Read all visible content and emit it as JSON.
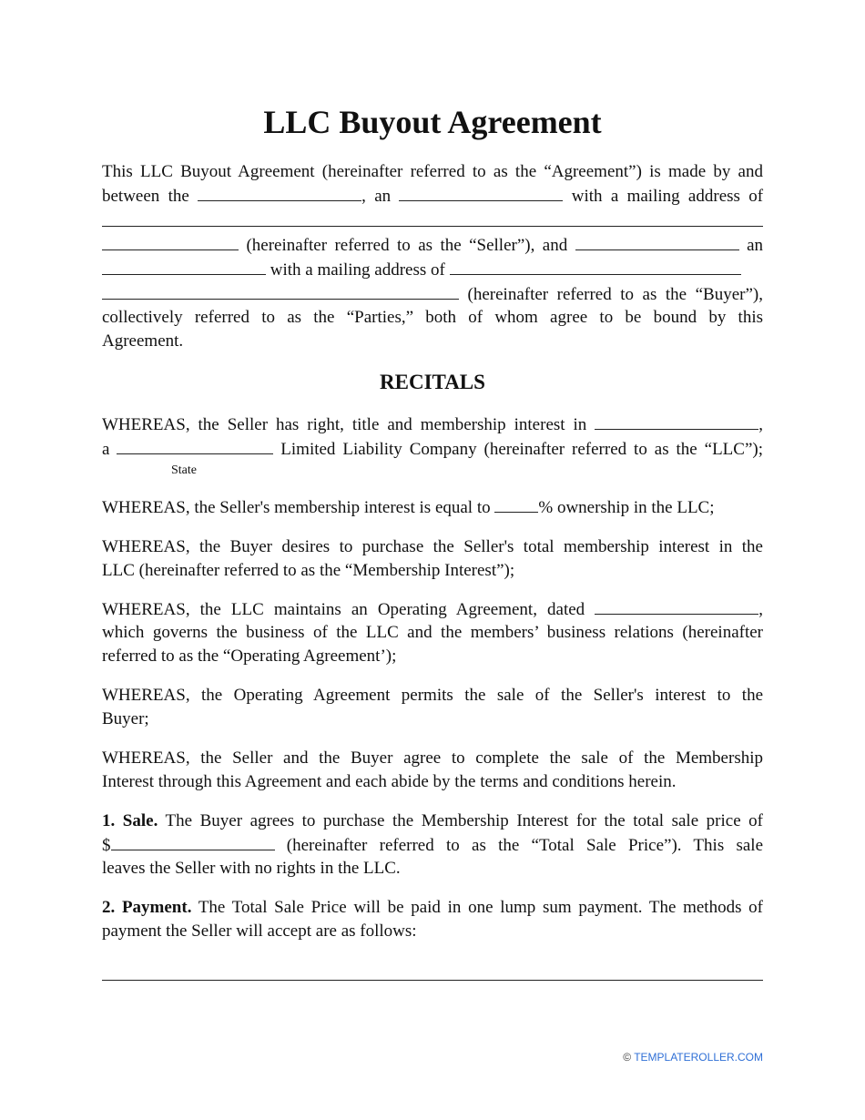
{
  "title": "LLC Buyout Agreement",
  "intro": {
    "l1": "This LLC Buyout Agreement (hereinafter referred to as the “Agreement”) is made by and",
    "l2a": "between the",
    "l2b": ", an",
    "l2c": "with a mailing address of",
    "l4": "(hereinafter referred to as the “Seller”), and",
    "l4b": "an",
    "l5": "with a mailing address of",
    "l6": "(hereinafter referred to as the “Buyer”),",
    "l7": "collectively referred to as the “Parties,” both of whom agree to be bound by this",
    "l8": "Agreement."
  },
  "recitals_heading": "RECITALS",
  "recitals": {
    "r1a": "WHEREAS, the Seller has right, title and membership interest in",
    "r1b": ",",
    "r1c": "a",
    "r1d": "Limited Liability Company (hereinafter referred to as the “LLC”);",
    "state_label": "State",
    "r2a": "WHEREAS, the Seller's membership interest is equal to",
    "r2b": "% ownership in the LLC;",
    "r3l1": "WHEREAS, the Buyer desires to purchase the Seller's total membership interest in the",
    "r3l2": "LLC (hereinafter referred to as the “Membership Interest”);",
    "r4a": "WHEREAS, the LLC maintains an Operating Agreement, dated",
    "r4b": ",",
    "r4l2": "which governs the business of the LLC and the members’ business relations (hereinafter",
    "r4l3": "referred to as the “Operating Agreement’);",
    "r5l1": "WHEREAS, the Operating Agreement permits the sale of the Seller's interest to the",
    "r5l2": "Buyer;",
    "r6l1": "WHEREAS, the Seller and the Buyer agree to complete the sale of the Membership",
    "r6l2": "Interest through this Agreement and each abide by the terms and conditions herein."
  },
  "sections": {
    "s1_label": "1. Sale.",
    "s1l1": "The Buyer agrees to purchase the Membership Interest for the total sale price of",
    "s1_dollar": "$",
    "s1l2": "(hereinafter referred to as the “Total Sale Price”). This sale",
    "s1l3": "leaves the Seller with no rights in the LLC.",
    "s2_label": "2. Payment.",
    "s2l1": "The Total Sale Price will be paid in one lump sum payment. The methods of",
    "s2l2": "payment the Seller will accept are as follows:"
  },
  "footer": {
    "copyright": "©",
    "site": "TEMPLATEROLLER.COM",
    "link_color": "#2f6fd6"
  }
}
